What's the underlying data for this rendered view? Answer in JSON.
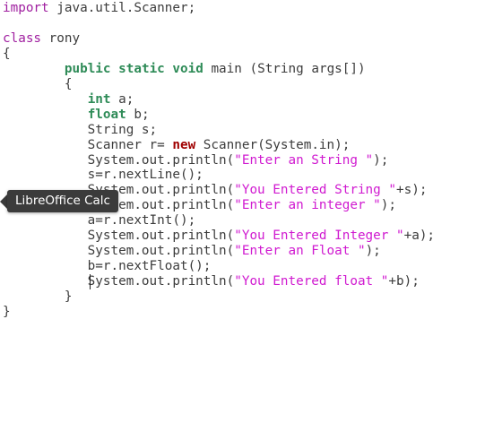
{
  "editor": {
    "lines": [
      {
        "segments": [
          {
            "text": "import",
            "style": "kw-purple"
          },
          {
            "text": " java.util.Scanner;",
            "style": "plain"
          }
        ]
      },
      {
        "segments": []
      },
      {
        "segments": [
          {
            "text": "class",
            "style": "kw-purple"
          },
          {
            "text": " rony",
            "style": "plain"
          }
        ]
      },
      {
        "segments": [
          {
            "text": "{",
            "style": "plain"
          }
        ]
      },
      {
        "segments": [
          {
            "text": "        ",
            "style": "plain"
          },
          {
            "text": "public",
            "style": "kw-green"
          },
          {
            "text": " ",
            "style": "plain"
          },
          {
            "text": "static",
            "style": "kw-green"
          },
          {
            "text": " ",
            "style": "plain"
          },
          {
            "text": "void",
            "style": "kw-green"
          },
          {
            "text": " main (String args[])",
            "style": "plain"
          }
        ]
      },
      {
        "segments": [
          {
            "text": "        {",
            "style": "plain"
          }
        ]
      },
      {
        "segments": [
          {
            "text": "           ",
            "style": "plain"
          },
          {
            "text": "int",
            "style": "kw-green"
          },
          {
            "text": " a;",
            "style": "plain"
          }
        ]
      },
      {
        "segments": [
          {
            "text": "           ",
            "style": "plain"
          },
          {
            "text": "float",
            "style": "kw-green"
          },
          {
            "text": " b;",
            "style": "plain"
          }
        ]
      },
      {
        "segments": [
          {
            "text": "           String s;",
            "style": "plain"
          }
        ]
      },
      {
        "segments": [
          {
            "text": "           Scanner r= ",
            "style": "plain"
          },
          {
            "text": "new",
            "style": "kw-red"
          },
          {
            "text": " Scanner(System.in);",
            "style": "plain"
          }
        ]
      },
      {
        "segments": [
          {
            "text": "           System.out.println(",
            "style": "plain"
          },
          {
            "text": "\"Enter an String \"",
            "style": "str"
          },
          {
            "text": ");",
            "style": "plain"
          }
        ]
      },
      {
        "segments": [
          {
            "text": "           s=r.nextLine();",
            "style": "plain"
          }
        ]
      },
      {
        "segments": [
          {
            "text": "           System.out.println(",
            "style": "plain"
          },
          {
            "text": "\"You Entered String \"",
            "style": "str"
          },
          {
            "text": "+s);",
            "style": "plain"
          }
        ]
      },
      {
        "segments": [
          {
            "text": "           System.out.println(",
            "style": "plain"
          },
          {
            "text": "\"Enter an integer \"",
            "style": "str"
          },
          {
            "text": ");",
            "style": "plain"
          }
        ]
      },
      {
        "segments": [
          {
            "text": "           a=r.nextInt();",
            "style": "plain"
          }
        ]
      },
      {
        "segments": [
          {
            "text": "           System.out.println(",
            "style": "plain"
          },
          {
            "text": "\"You Entered Integer \"",
            "style": "str"
          },
          {
            "text": "+a);",
            "style": "plain"
          }
        ]
      },
      {
        "segments": [
          {
            "text": "           System.out.println(",
            "style": "plain"
          },
          {
            "text": "\"Enter an Float \"",
            "style": "str"
          },
          {
            "text": ");",
            "style": "plain"
          }
        ]
      },
      {
        "segments": [
          {
            "text": "           b=r.nextFloat();",
            "style": "plain"
          }
        ]
      },
      {
        "segments": [
          {
            "text": "           System.out.println(",
            "style": "plain"
          },
          {
            "text": "\"You Entered float \"",
            "style": "str"
          },
          {
            "text": "+b);",
            "style": "plain"
          }
        ]
      },
      {
        "segments": [
          {
            "text": "        }",
            "style": "plain"
          }
        ]
      },
      {
        "segments": [
          {
            "text": "}",
            "style": "plain"
          }
        ]
      }
    ]
  },
  "tooltip": {
    "label": "LibreOffice Calc"
  }
}
